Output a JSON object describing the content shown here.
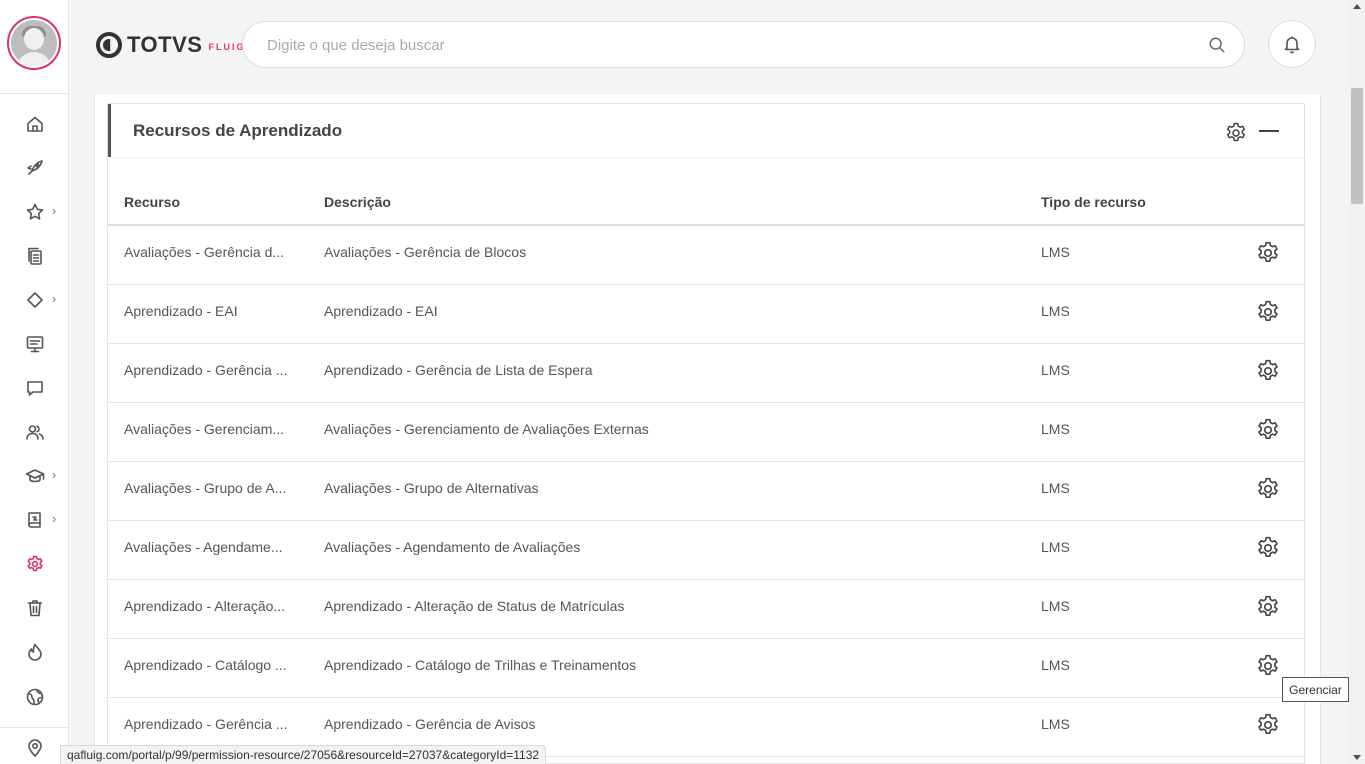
{
  "header": {
    "logo_text": "TOTVS",
    "logo_sub": "FLUIG",
    "search_placeholder": "Digite o que deseja buscar"
  },
  "sidebar": {
    "items": [
      {
        "name": "home-icon"
      },
      {
        "name": "rocket-icon"
      },
      {
        "name": "star-icon",
        "has_submenu": true
      },
      {
        "name": "documents-icon"
      },
      {
        "name": "workflow-icon",
        "has_submenu": true
      },
      {
        "name": "dashboard-icon"
      },
      {
        "name": "chat-icon"
      },
      {
        "name": "people-icon"
      },
      {
        "name": "graduation-cap-icon",
        "has_submenu": true
      },
      {
        "name": "book-icon",
        "has_submenu": true
      },
      {
        "name": "settings-icon",
        "active": true
      },
      {
        "name": "trash-icon"
      },
      {
        "name": "fire-icon"
      },
      {
        "name": "globe-icon"
      },
      {
        "name": "location-pin-icon"
      }
    ],
    "active_color": "#d9346b"
  },
  "widget": {
    "title": "Recursos de Aprendizado",
    "columns": {
      "recurso": "Recurso",
      "descricao": "Descrição",
      "tipo": "Tipo de recurso"
    },
    "rows": [
      {
        "recurso": "Avaliações - Gerência d...",
        "descricao": "Avaliações - Gerência de Blocos",
        "tipo": "LMS"
      },
      {
        "recurso": "Aprendizado - EAI",
        "descricao": "Aprendizado - EAI",
        "tipo": "LMS"
      },
      {
        "recurso": "Aprendizado - Gerência ...",
        "descricao": "Aprendizado - Gerência de Lista de Espera",
        "tipo": "LMS"
      },
      {
        "recurso": "Avaliações - Gerenciam...",
        "descricao": "Avaliações - Gerenciamento de Avaliações Externas",
        "tipo": "LMS"
      },
      {
        "recurso": "Avaliações - Grupo de A...",
        "descricao": "Avaliações - Grupo de Alternativas",
        "tipo": "LMS"
      },
      {
        "recurso": "Avaliações - Agendame...",
        "descricao": "Avaliações - Agendamento de Avaliações",
        "tipo": "LMS"
      },
      {
        "recurso": "Aprendizado - Alteração...",
        "descricao": "Aprendizado - Alteração de Status de Matrículas",
        "tipo": "LMS"
      },
      {
        "recurso": "Aprendizado - Catálogo ...",
        "descricao": "Aprendizado - Catálogo de Trilhas e Treinamentos",
        "tipo": "LMS"
      },
      {
        "recurso": "Aprendizado - Gerência ...",
        "descricao": "Aprendizado - Gerência de Avisos",
        "tipo": "LMS"
      }
    ]
  },
  "tooltip": "Gerenciar",
  "status_url": "qafluig.com/portal/p/99/permission-resource/27056&resourceId=27037&categoryId=1132"
}
